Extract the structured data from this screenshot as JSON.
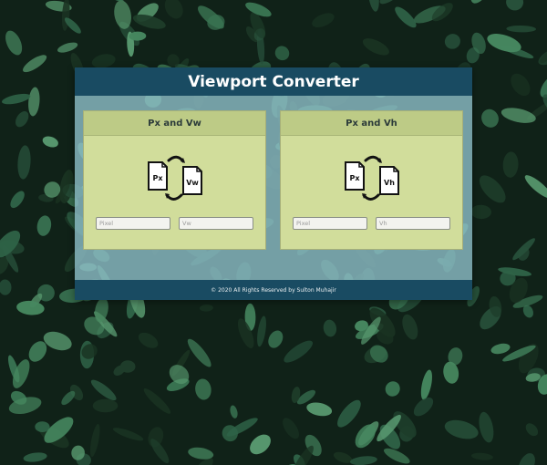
{
  "app": {
    "title": "Viewport Converter",
    "footer": "© 2020 All Rights Reserved by Sulton Muhajir"
  },
  "cards": [
    {
      "title": "Px and Vw",
      "doc_from": "Px",
      "doc_to": "Vw",
      "input_px": {
        "placeholder": "Pixel",
        "value": ""
      },
      "input_v": {
        "placeholder": "Vw",
        "value": ""
      }
    },
    {
      "title": "Px and Vh",
      "doc_from": "Px",
      "doc_to": "Vh",
      "input_px": {
        "placeholder": "Pixel",
        "value": ""
      },
      "input_v": {
        "placeholder": "Vh",
        "value": ""
      }
    }
  ],
  "colors": {
    "header_bg": "#194b62",
    "panel_bg": "#8bbbc4",
    "card_bg": "#d1dd9b",
    "card_title_bg": "#bdcb86",
    "background": "#0f1f16"
  },
  "icons": [
    "leaf-background",
    "document-icon",
    "arrow-icon"
  ]
}
